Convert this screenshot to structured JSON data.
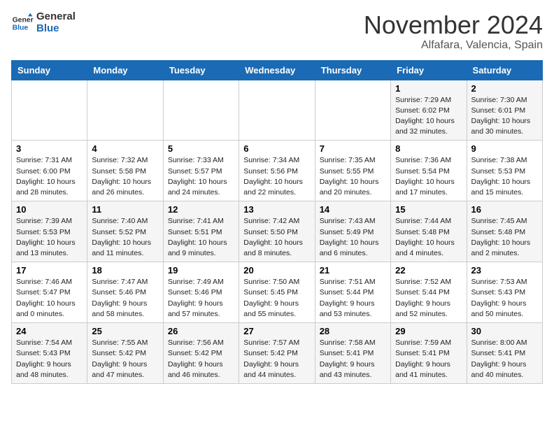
{
  "header": {
    "logo_line1": "General",
    "logo_line2": "Blue",
    "month": "November 2024",
    "location": "Alfafara, Valencia, Spain"
  },
  "columns": [
    "Sunday",
    "Monday",
    "Tuesday",
    "Wednesday",
    "Thursday",
    "Friday",
    "Saturday"
  ],
  "weeks": [
    [
      {
        "day": "",
        "info": ""
      },
      {
        "day": "",
        "info": ""
      },
      {
        "day": "",
        "info": ""
      },
      {
        "day": "",
        "info": ""
      },
      {
        "day": "",
        "info": ""
      },
      {
        "day": "1",
        "info": "Sunrise: 7:29 AM\nSunset: 6:02 PM\nDaylight: 10 hours\nand 32 minutes."
      },
      {
        "day": "2",
        "info": "Sunrise: 7:30 AM\nSunset: 6:01 PM\nDaylight: 10 hours\nand 30 minutes."
      }
    ],
    [
      {
        "day": "3",
        "info": "Sunrise: 7:31 AM\nSunset: 6:00 PM\nDaylight: 10 hours\nand 28 minutes."
      },
      {
        "day": "4",
        "info": "Sunrise: 7:32 AM\nSunset: 5:58 PM\nDaylight: 10 hours\nand 26 minutes."
      },
      {
        "day": "5",
        "info": "Sunrise: 7:33 AM\nSunset: 5:57 PM\nDaylight: 10 hours\nand 24 minutes."
      },
      {
        "day": "6",
        "info": "Sunrise: 7:34 AM\nSunset: 5:56 PM\nDaylight: 10 hours\nand 22 minutes."
      },
      {
        "day": "7",
        "info": "Sunrise: 7:35 AM\nSunset: 5:55 PM\nDaylight: 10 hours\nand 20 minutes."
      },
      {
        "day": "8",
        "info": "Sunrise: 7:36 AM\nSunset: 5:54 PM\nDaylight: 10 hours\nand 17 minutes."
      },
      {
        "day": "9",
        "info": "Sunrise: 7:38 AM\nSunset: 5:53 PM\nDaylight: 10 hours\nand 15 minutes."
      }
    ],
    [
      {
        "day": "10",
        "info": "Sunrise: 7:39 AM\nSunset: 5:53 PM\nDaylight: 10 hours\nand 13 minutes."
      },
      {
        "day": "11",
        "info": "Sunrise: 7:40 AM\nSunset: 5:52 PM\nDaylight: 10 hours\nand 11 minutes."
      },
      {
        "day": "12",
        "info": "Sunrise: 7:41 AM\nSunset: 5:51 PM\nDaylight: 10 hours\nand 9 minutes."
      },
      {
        "day": "13",
        "info": "Sunrise: 7:42 AM\nSunset: 5:50 PM\nDaylight: 10 hours\nand 8 minutes."
      },
      {
        "day": "14",
        "info": "Sunrise: 7:43 AM\nSunset: 5:49 PM\nDaylight: 10 hours\nand 6 minutes."
      },
      {
        "day": "15",
        "info": "Sunrise: 7:44 AM\nSunset: 5:48 PM\nDaylight: 10 hours\nand 4 minutes."
      },
      {
        "day": "16",
        "info": "Sunrise: 7:45 AM\nSunset: 5:48 PM\nDaylight: 10 hours\nand 2 minutes."
      }
    ],
    [
      {
        "day": "17",
        "info": "Sunrise: 7:46 AM\nSunset: 5:47 PM\nDaylight: 10 hours\nand 0 minutes."
      },
      {
        "day": "18",
        "info": "Sunrise: 7:47 AM\nSunset: 5:46 PM\nDaylight: 9 hours\nand 58 minutes."
      },
      {
        "day": "19",
        "info": "Sunrise: 7:49 AM\nSunset: 5:46 PM\nDaylight: 9 hours\nand 57 minutes."
      },
      {
        "day": "20",
        "info": "Sunrise: 7:50 AM\nSunset: 5:45 PM\nDaylight: 9 hours\nand 55 minutes."
      },
      {
        "day": "21",
        "info": "Sunrise: 7:51 AM\nSunset: 5:44 PM\nDaylight: 9 hours\nand 53 minutes."
      },
      {
        "day": "22",
        "info": "Sunrise: 7:52 AM\nSunset: 5:44 PM\nDaylight: 9 hours\nand 52 minutes."
      },
      {
        "day": "23",
        "info": "Sunrise: 7:53 AM\nSunset: 5:43 PM\nDaylight: 9 hours\nand 50 minutes."
      }
    ],
    [
      {
        "day": "24",
        "info": "Sunrise: 7:54 AM\nSunset: 5:43 PM\nDaylight: 9 hours\nand 48 minutes."
      },
      {
        "day": "25",
        "info": "Sunrise: 7:55 AM\nSunset: 5:42 PM\nDaylight: 9 hours\nand 47 minutes."
      },
      {
        "day": "26",
        "info": "Sunrise: 7:56 AM\nSunset: 5:42 PM\nDaylight: 9 hours\nand 46 minutes."
      },
      {
        "day": "27",
        "info": "Sunrise: 7:57 AM\nSunset: 5:42 PM\nDaylight: 9 hours\nand 44 minutes."
      },
      {
        "day": "28",
        "info": "Sunrise: 7:58 AM\nSunset: 5:41 PM\nDaylight: 9 hours\nand 43 minutes."
      },
      {
        "day": "29",
        "info": "Sunrise: 7:59 AM\nSunset: 5:41 PM\nDaylight: 9 hours\nand 41 minutes."
      },
      {
        "day": "30",
        "info": "Sunrise: 8:00 AM\nSunset: 5:41 PM\nDaylight: 9 hours\nand 40 minutes."
      }
    ]
  ]
}
